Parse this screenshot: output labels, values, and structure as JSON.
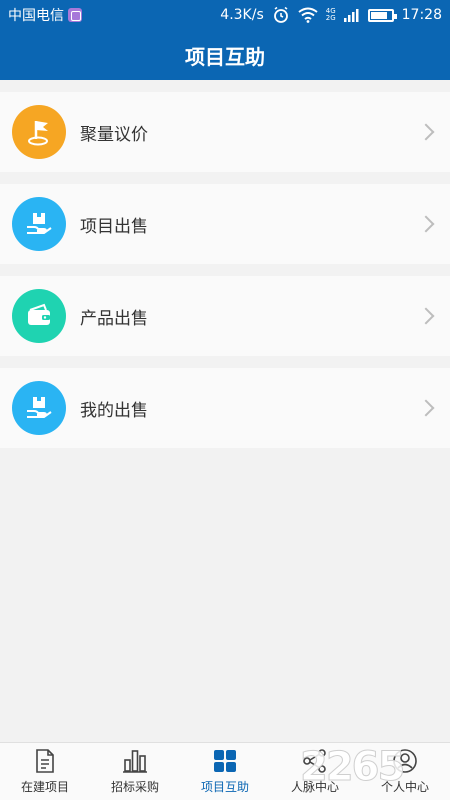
{
  "status_bar": {
    "carrier": "中国电信",
    "net_speed": "4.3K/s",
    "time": "17:28",
    "battery_level": 0.8,
    "network_small_top": "4G",
    "network_small_bottom": "2G"
  },
  "header": {
    "title": "项目互助"
  },
  "menu": [
    {
      "label": "聚量议价",
      "icon": "flag-icon",
      "color": "#f6a623"
    },
    {
      "label": "项目出售",
      "icon": "hand-box-icon",
      "color": "#2ab4f3"
    },
    {
      "label": "产品出售",
      "icon": "wallet-icon",
      "color": "#1fd3b1"
    },
    {
      "label": "我的出售",
      "icon": "hand-box-icon",
      "color": "#2ab4f3"
    }
  ],
  "bottom_nav": {
    "items": [
      {
        "label": "在建项目",
        "icon": "document-icon"
      },
      {
        "label": "招标采购",
        "icon": "bar-chart-icon"
      },
      {
        "label": "项目互助",
        "icon": "grid-icon",
        "active": true
      },
      {
        "label": "人脉中心",
        "icon": "network-icon"
      },
      {
        "label": "个人中心",
        "icon": "user-icon"
      }
    ],
    "active_color": "#0b66b3"
  },
  "watermark": {
    "text": "2265"
  }
}
